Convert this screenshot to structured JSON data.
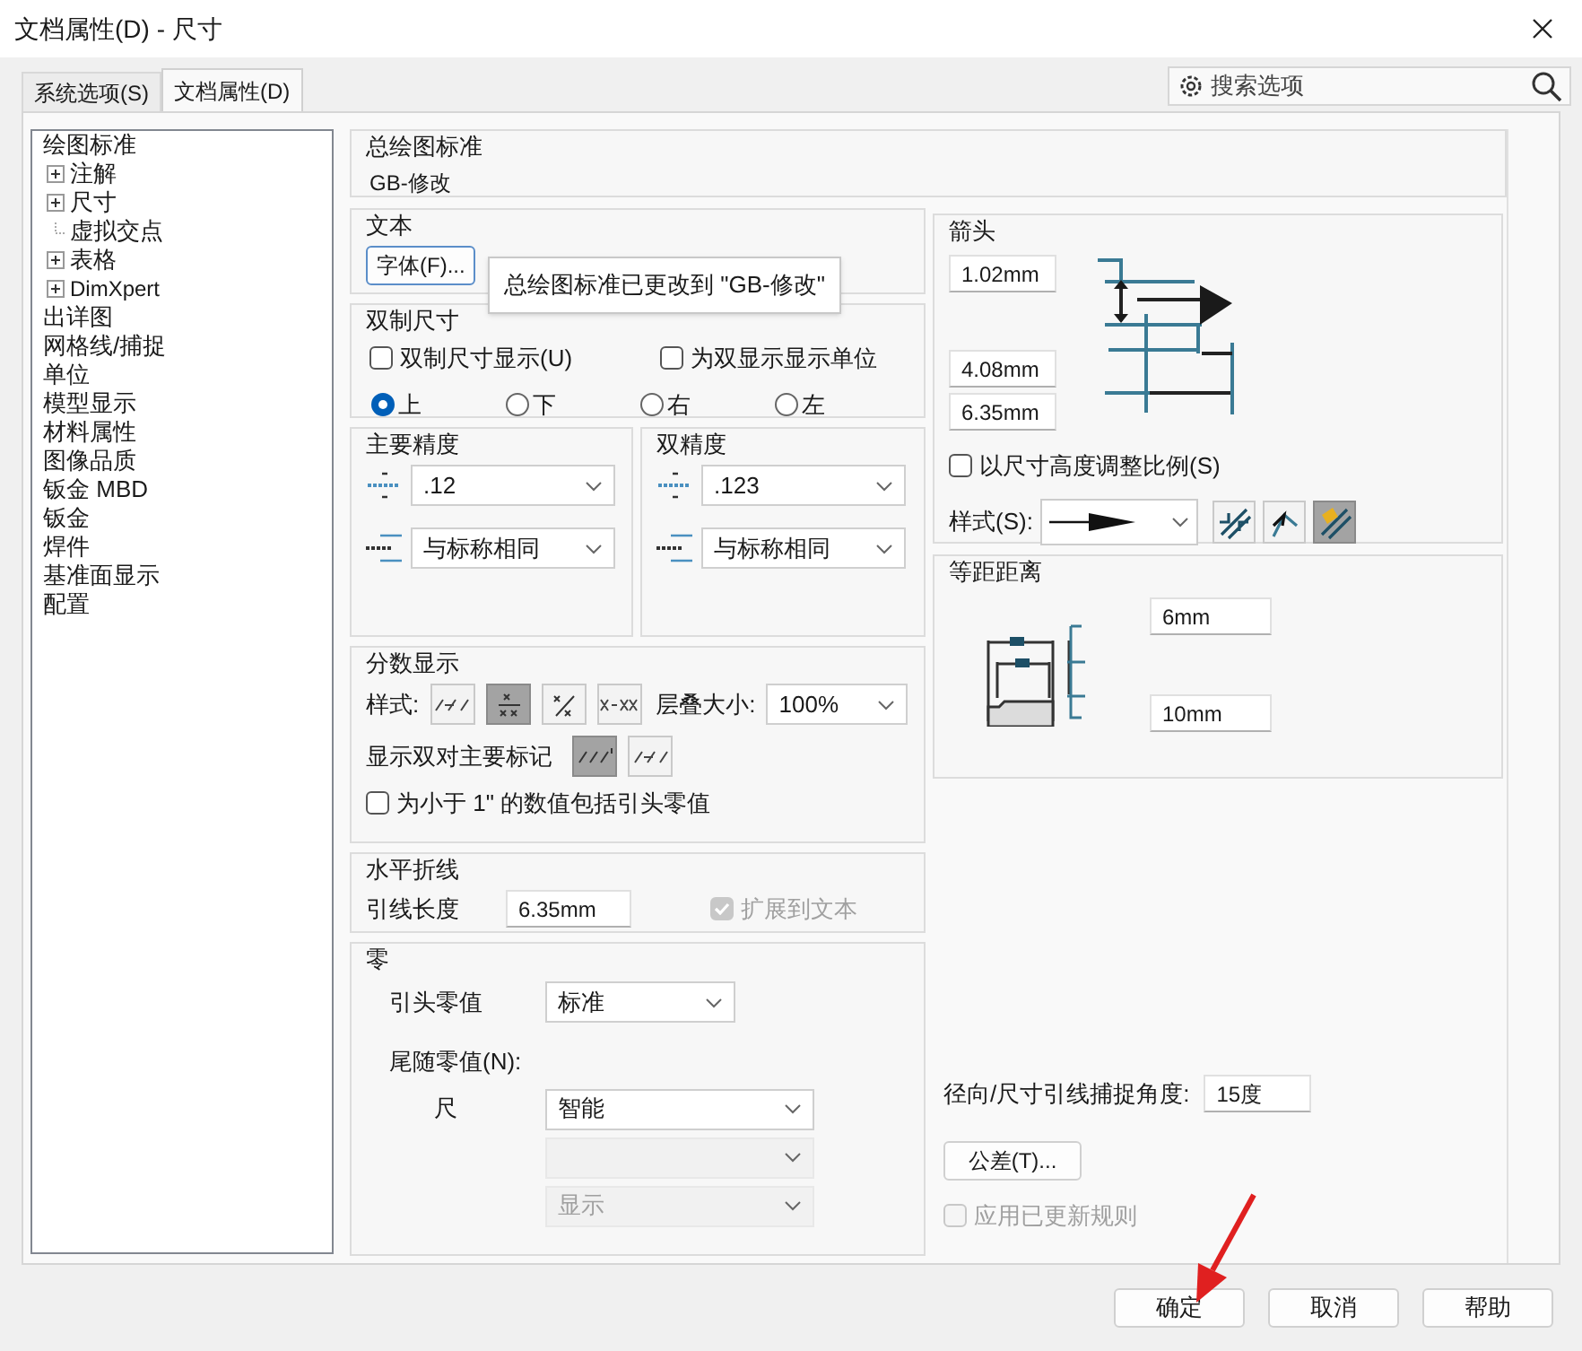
{
  "window": {
    "title": "文档属性(D) - 尺寸"
  },
  "tabs": [
    {
      "label": "系统选项(S)",
      "selected": false
    },
    {
      "label": "文档属性(D)",
      "selected": true
    }
  ],
  "search": {
    "placeholder": "搜索选项"
  },
  "tree": [
    {
      "label": "绘图标准",
      "children": [
        {
          "label": "注解",
          "expandable": true
        },
        {
          "label": "尺寸",
          "expandable": true
        },
        {
          "label": "虚拟交点",
          "expandable": false
        },
        {
          "label": "表格",
          "expandable": true
        },
        {
          "label": "DimXpert",
          "expandable": true
        }
      ]
    },
    {
      "label": "出详图"
    },
    {
      "label": "网格线/捕捉"
    },
    {
      "label": "单位"
    },
    {
      "label": "模型显示"
    },
    {
      "label": "材料属性"
    },
    {
      "label": "图像品质"
    },
    {
      "label": "钣金 MBD"
    },
    {
      "label": "钣金"
    },
    {
      "label": "焊件"
    },
    {
      "label": "基准面显示"
    },
    {
      "label": "配置"
    }
  ],
  "drawing_standard": {
    "title": "总绘图标准",
    "value": "GB-修改"
  },
  "text_group": {
    "title": "文本",
    "font_button": "字体(F)..."
  },
  "tooltip": "总绘图标准已更改到 \"GB-修改\"",
  "dual": {
    "title": "双制尺寸",
    "checkboxes": [
      {
        "label": "双制尺寸显示(U)",
        "checked": false
      },
      {
        "label": "为双显示显示单位",
        "checked": false
      }
    ],
    "positions": [
      {
        "label": "上",
        "selected": true
      },
      {
        "label": "下",
        "selected": false
      },
      {
        "label": "右",
        "selected": false
      },
      {
        "label": "左",
        "selected": false
      }
    ]
  },
  "precision": [
    {
      "title": "主要精度",
      "value": ".12",
      "tolerance": "与标称相同"
    },
    {
      "title": "双精度",
      "value": ".123",
      "tolerance": "与标称相同"
    }
  ],
  "fraction": {
    "title": "分数显示",
    "style_label": "样式:",
    "styles": [
      {
        "kind": "slash",
        "selected": false
      },
      {
        "kind": "stacked",
        "selected": true
      },
      {
        "kind": "diagonal",
        "selected": false
      },
      {
        "kind": "dash",
        "selected": false
      }
    ],
    "stack_label": "层叠大小:",
    "stack_value": "100%",
    "dual_label": "显示双对主要标记",
    "dual_styles": [
      {
        "kind": "inch",
        "selected": true
      },
      {
        "kind": "slash",
        "selected": false
      }
    ],
    "checkbox": {
      "label": "为小于 1\" 的数值包括引头零值",
      "checked": false
    }
  },
  "horizontal": {
    "title": "水平折线",
    "label": "引线长度",
    "value": "6.35mm",
    "checkbox": {
      "label": "扩展到文本",
      "checked": true,
      "disabled": true
    }
  },
  "zeros": {
    "title": "零",
    "leading_label": "引头零值",
    "leading_value": "标准",
    "trailing_label": "尾随零值(N):",
    "rows": [
      {
        "label": "尺",
        "value": "智能",
        "disabled": false
      },
      {
        "disabled": true
      },
      {
        "value": "显示",
        "disabled": true
      }
    ]
  },
  "arrows": {
    "title": "箭头",
    "values": [
      "1.02mm",
      "4.08mm",
      "6.35mm"
    ],
    "checkbox": {
      "label": "以尺寸高度调整比例(S)",
      "checked": false
    },
    "style_label": "样式(S):",
    "placement": [
      {
        "kind": "inside",
        "selected": false
      },
      {
        "kind": "outside",
        "selected": false
      },
      {
        "kind": "smart",
        "selected": true
      }
    ]
  },
  "offset": {
    "title": "等距距离",
    "values": [
      "6mm",
      "10mm"
    ]
  },
  "snap": {
    "label": "径向/尺寸引线捕捉角度:",
    "value": "15度"
  },
  "tolerance_button": "公差(T)...",
  "apply_rules": {
    "label": "应用已更新规则",
    "checked": false,
    "disabled": true
  },
  "buttons": [
    "确定",
    "取消",
    "帮助"
  ]
}
